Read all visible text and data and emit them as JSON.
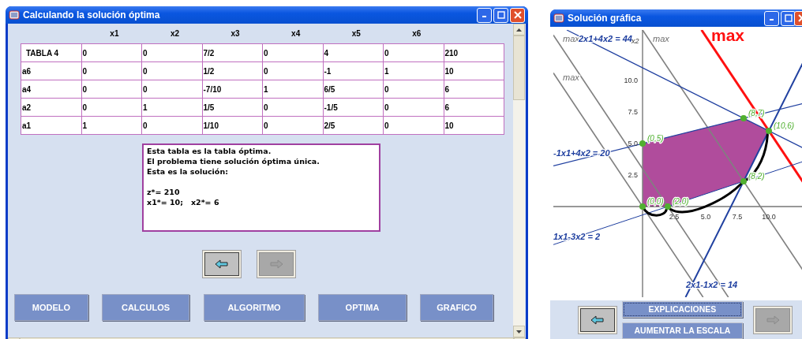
{
  "left_window": {
    "title": "Calculando la solución óptima",
    "table": {
      "columns": [
        "x1",
        "x2",
        "x3",
        "x4",
        "x5",
        "x6"
      ],
      "rows": [
        {
          "label": "TABLA 4",
          "cells": [
            "0",
            "0",
            "7/2",
            "0",
            "4",
            "0",
            "210"
          ]
        },
        {
          "label": "a6",
          "cells": [
            "0",
            "0",
            "1/2",
            "0",
            "-1",
            "1",
            "10"
          ]
        },
        {
          "label": "a4",
          "cells": [
            "0",
            "0",
            "-7/10",
            "1",
            "6/5",
            "0",
            "6"
          ]
        },
        {
          "label": "a2",
          "cells": [
            "0",
            "1",
            "1/5",
            "0",
            "-1/5",
            "0",
            "6"
          ]
        },
        {
          "label": "a1",
          "cells": [
            "1",
            "0",
            "1/10",
            "0",
            "2/5",
            "0",
            "10"
          ]
        }
      ]
    },
    "message": [
      [
        "Esta tabla es la tabla óptima.",
        "El problema tiene solución óptima única.",
        "Esta es la solución:"
      ],
      [
        "z*= 210",
        "x1*= 10;   x2*= 6"
      ]
    ],
    "nav_buttons": [
      {
        "kind": "back",
        "disabled": false
      },
      {
        "kind": "forward",
        "disabled": true
      }
    ],
    "tabs": [
      "MODELO",
      "CALCULOS",
      "ALGORITMO",
      "OPTIMA",
      "GRAFICO"
    ]
  },
  "right_window": {
    "title": "Solución gráfica",
    "graph": {
      "axis_label": "x2",
      "yticks": [
        "10.0",
        "7.5",
        "5.0",
        "2.5"
      ],
      "xticks": [
        "2.5",
        "5.0",
        "7.5",
        "10.0"
      ],
      "constraints": [
        {
          "label": "2x1+4x2 = 44"
        },
        {
          "label": "-1x1+4x2 = 20"
        },
        {
          "label": "1x1-3x2 = 2"
        },
        {
          "label": "2x1-1x2 = 14"
        }
      ],
      "vertices": [
        {
          "label": "(0,0)"
        },
        {
          "label": "(2,0)"
        },
        {
          "label": "(8,2)"
        },
        {
          "label": "(10,6)"
        },
        {
          "label": "(8,7)"
        },
        {
          "label": "(0,5)"
        }
      ],
      "level_lines": [
        "max",
        "max",
        "max"
      ],
      "objective": "max"
    },
    "nav_buttons": [
      {
        "kind": "back",
        "disabled": false
      },
      {
        "kind": "forward",
        "disabled": true
      }
    ],
    "actions": [
      {
        "label": "EXPLICACIONES",
        "focused": true
      },
      {
        "label": "AUMENTAR LA ESCALA",
        "focused": false
      }
    ]
  }
}
